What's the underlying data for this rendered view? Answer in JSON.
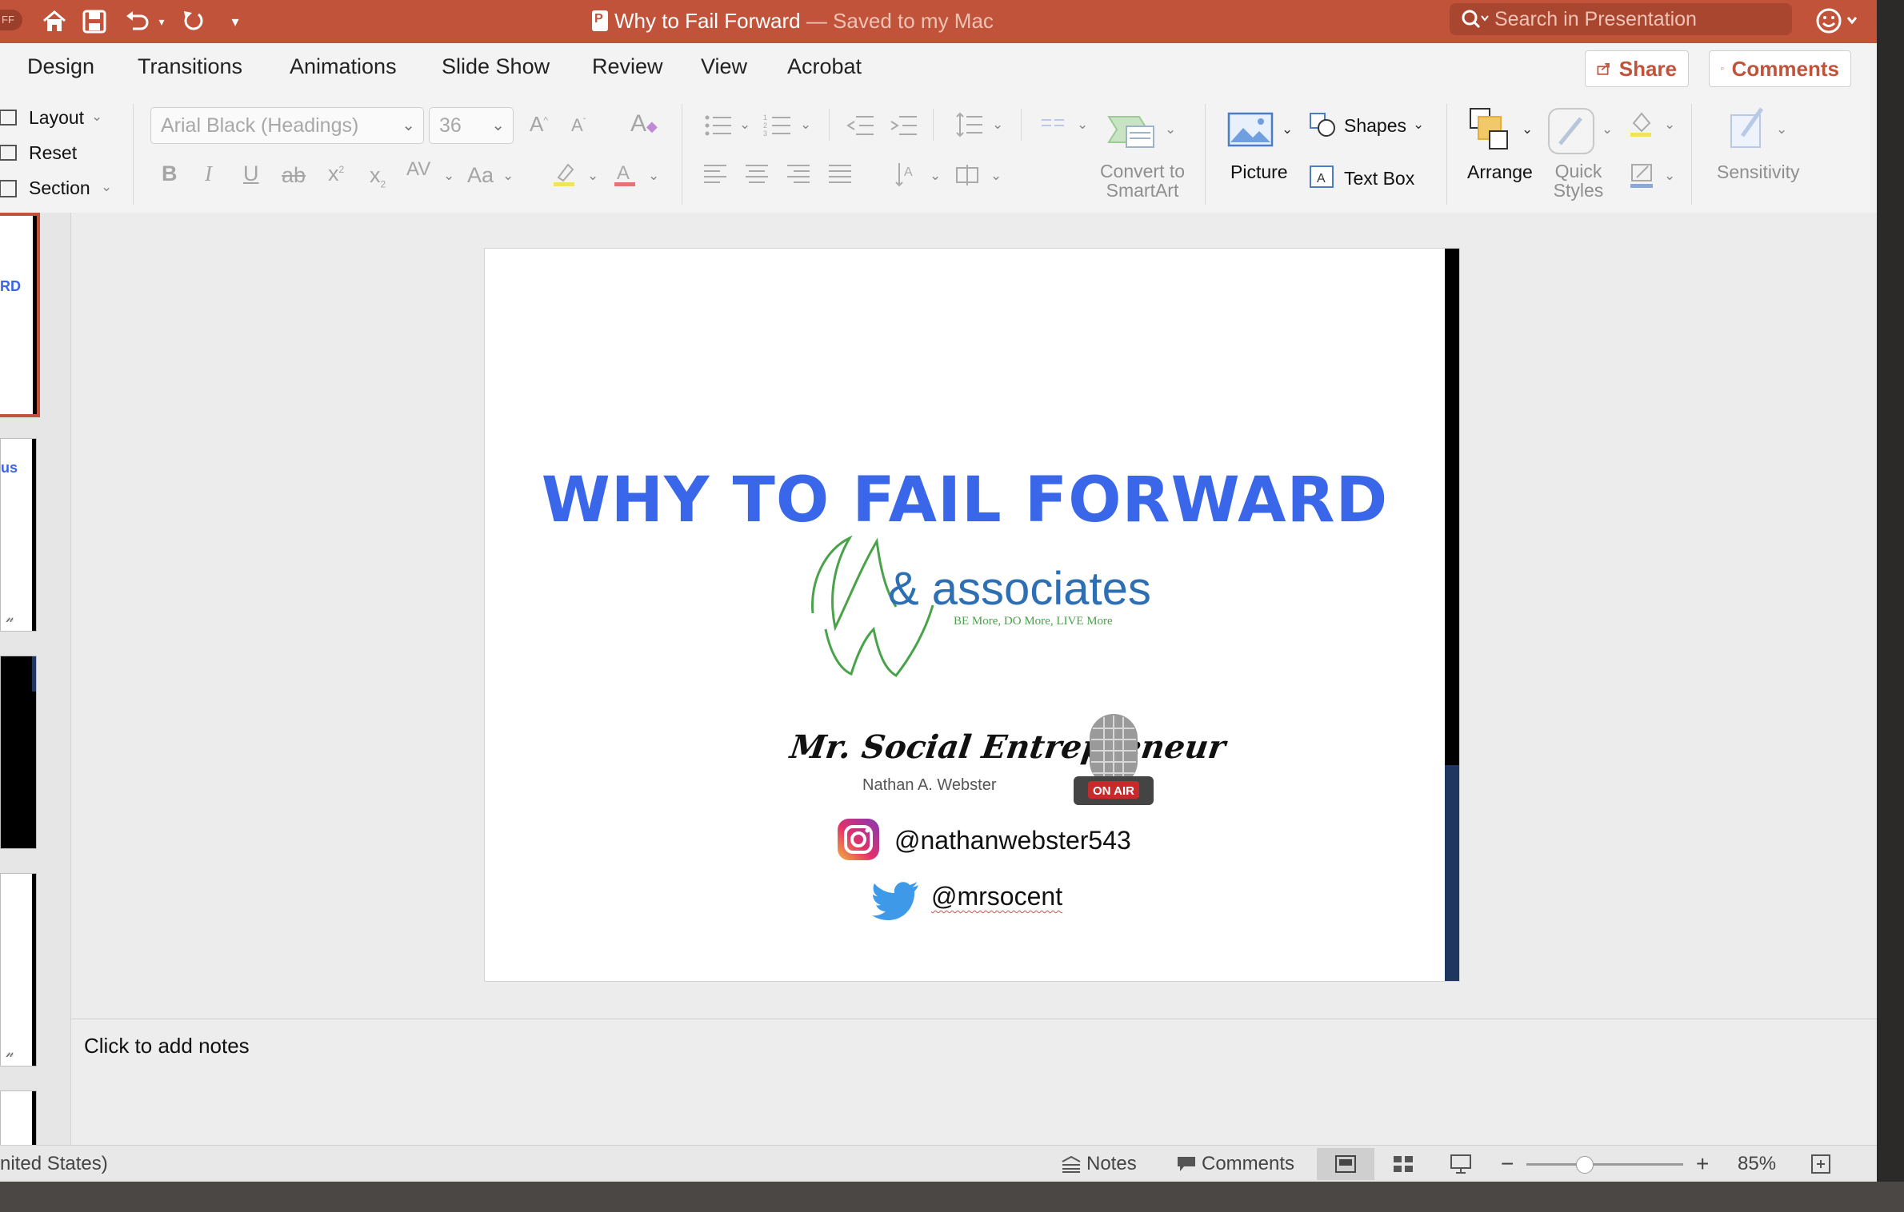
{
  "titlebar": {
    "status_pill": "FF",
    "doc_name": "Why to Fail Forward",
    "doc_status": " — Saved to my Mac",
    "search_placeholder": "Search in Presentation"
  },
  "tabs": [
    "Design",
    "Transitions",
    "Animations",
    "Slide Show",
    "Review",
    "View",
    "Acrobat"
  ],
  "share_label": "Share",
  "comments_label": "Comments",
  "ribbon": {
    "layout_label": "Layout",
    "reset_label": "Reset",
    "section_label": "Section",
    "font_name": "Arial Black (Headings)",
    "font_size": "36",
    "convert_smartart_line1": "Convert to",
    "convert_smartart_line2": "SmartArt",
    "picture_label": "Picture",
    "shapes_label": "Shapes",
    "textbox_label": "Text Box",
    "arrange_label": "Arrange",
    "quick_styles_line1": "Quick",
    "quick_styles_line2": "Styles",
    "sensitivity_label": "Sensitivity"
  },
  "thumbnails": [
    {
      "text": "RD",
      "selected": true
    },
    {
      "text": "us",
      "selected": false
    },
    {
      "text": "",
      "selected": false
    },
    {
      "text": "",
      "selected": false
    }
  ],
  "slide": {
    "title": "WHY TO FAIL FORWARD",
    "logo_text": "& associates",
    "logo_tagline": "BE More, DO More, LIVE More",
    "brand_title": "Mr. Social Entrepreneur",
    "brand_subtitle": "Nathan A. Webster",
    "mic_label": "ON AIR",
    "instagram_handle": "@nathanwebster543",
    "twitter_handle": "@mrsocent"
  },
  "notes_placeholder": "Click to add notes",
  "statusbar": {
    "language": "nited States)",
    "notes_label": "Notes",
    "comments_label": "Comments",
    "zoom_level": "85%",
    "zoom_fraction": 0.37
  },
  "colors": {
    "accent": "#c0533a",
    "slide_title": "#3a67e9",
    "logo_blue": "#2d6fb2",
    "logo_green": "#4aa24b"
  }
}
